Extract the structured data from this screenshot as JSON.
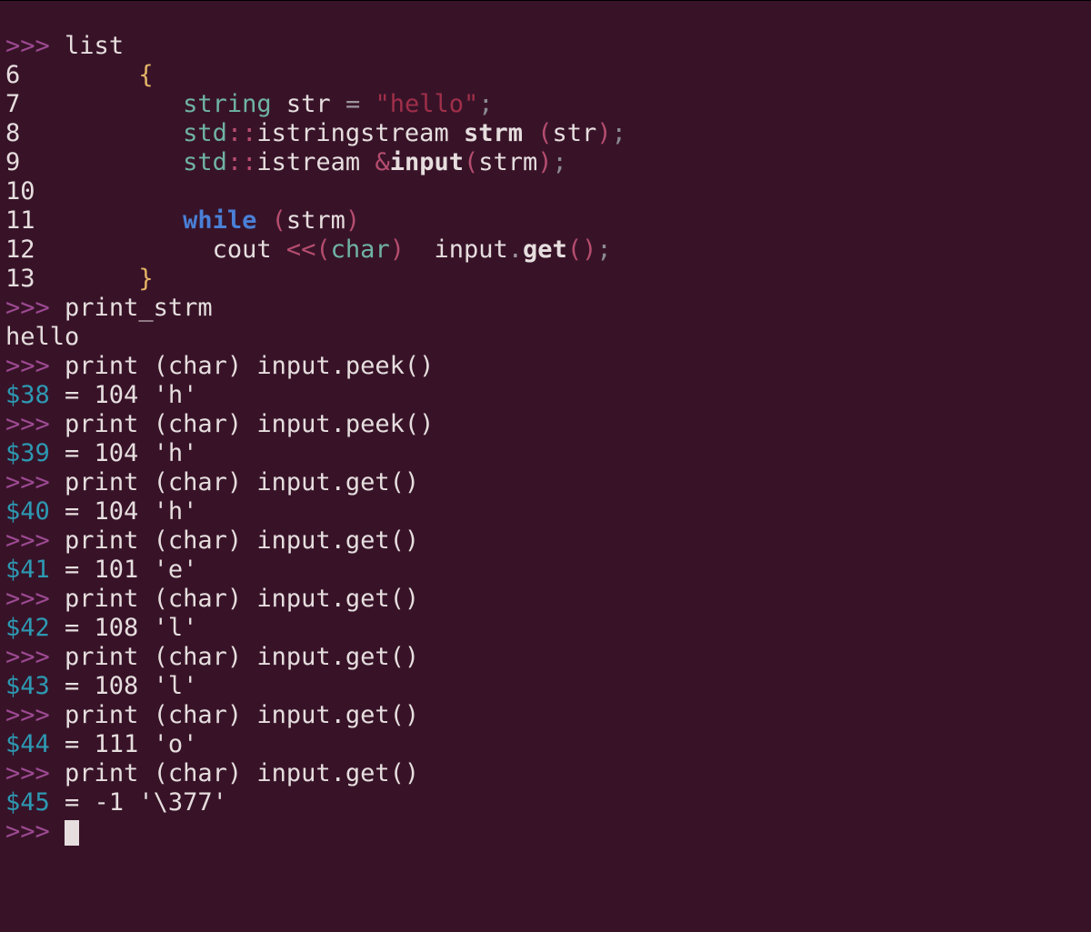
{
  "prompt": ">>>",
  "cmd_list": "list",
  "code": {
    "l6": {
      "no": "6",
      "brace": "{"
    },
    "l7": {
      "no": "7",
      "type": "string",
      "var": "str",
      "eq": "=",
      "str": "\"hello\"",
      "semi": ";"
    },
    "l8": {
      "no": "8",
      "ns": "std",
      "scope": "::",
      "cls": "istringstream",
      "name": "strm",
      "lp": "(",
      "arg": "str",
      "rp": ")",
      "semi": ";"
    },
    "l9": {
      "no": "9",
      "ns": "std",
      "scope": "::",
      "cls": "istream",
      "amp": "&",
      "name": "input",
      "lp": "(",
      "arg": "strm",
      "rp": ")",
      "semi": ";"
    },
    "l10": {
      "no": "10"
    },
    "l11": {
      "no": "11",
      "kw": "while",
      "lp": "(",
      "cond": "strm",
      "rp": ")"
    },
    "l12": {
      "no": "12",
      "cout": "cout",
      "ins": "<<",
      "lp": "(",
      "cast": "char",
      "rp": ")",
      "obj": "input",
      "dot": ".",
      "fn": "get",
      "lp2": "(",
      "rp2": ")",
      "semi": ";"
    },
    "l13": {
      "no": "13",
      "brace": "}"
    }
  },
  "cmd_ps": "print_strm",
  "out_hello": "hello",
  "calls": [
    {
      "cmd": "print (char) input.peek()",
      "id": "$38",
      "rest": " = 104 'h'"
    },
    {
      "cmd": "print (char) input.peek()",
      "id": "$39",
      "rest": " = 104 'h'"
    },
    {
      "cmd": "print (char) input.get()",
      "id": "$40",
      "rest": " = 104 'h'"
    },
    {
      "cmd": "print (char) input.get()",
      "id": "$41",
      "rest": " = 101 'e'"
    },
    {
      "cmd": "print (char) input.get()",
      "id": "$42",
      "rest": " = 108 'l'"
    },
    {
      "cmd": "print (char) input.get()",
      "id": "$43",
      "rest": " = 108 'l'"
    },
    {
      "cmd": "print (char) input.get()",
      "id": "$44",
      "rest": " = 111 'o'"
    },
    {
      "cmd": "print (char) input.get()",
      "id": "$45",
      "rest": " = -1 '\\377'"
    }
  ]
}
